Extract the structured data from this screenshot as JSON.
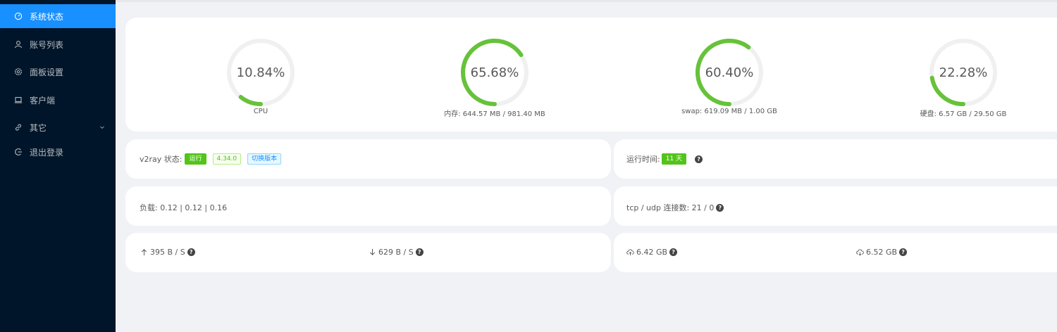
{
  "sidebar": {
    "items": [
      {
        "label": "系统状态",
        "icon": "dashboard-icon"
      },
      {
        "label": "账号列表",
        "icon": "user-icon"
      },
      {
        "label": "面板设置",
        "icon": "gear-icon"
      },
      {
        "label": "客户端",
        "icon": "laptop-icon"
      },
      {
        "label": "其它",
        "icon": "link-icon"
      },
      {
        "label": "退出登录",
        "icon": "logout-icon"
      }
    ]
  },
  "gauges": [
    {
      "percent_text": "10.84%",
      "value": 10.84,
      "caption": "CPU"
    },
    {
      "percent_text": "65.68%",
      "value": 65.68,
      "caption": "内存: 644.57 MB / 981.40 MB"
    },
    {
      "percent_text": "60.40%",
      "value": 60.4,
      "caption": "swap: 619.09 MB / 1.00 GB"
    },
    {
      "percent_text": "22.28%",
      "value": 22.28,
      "caption": "硬盘: 6.57 GB / 29.50 GB"
    }
  ],
  "v2ray": {
    "label": "v2ray 状态:",
    "status": "运行",
    "version": "4.34.0",
    "switch": "切换版本"
  },
  "uptime": {
    "label": "运行时间:",
    "value": "11 天",
    "help": "?"
  },
  "load": {
    "text": "负载: 0.12 | 0.12 | 0.16"
  },
  "connections": {
    "text": "tcp / udp 连接数: 21 / 0",
    "help": "?"
  },
  "traffic": {
    "upload_speed": "395 B / S",
    "download_speed": "629 B / S",
    "total_up": "6.42 GB",
    "total_down": "6.52 GB",
    "help": "?"
  },
  "colors": {
    "sidebar_bg": "#001529",
    "active": "#1890ff",
    "gauge": "#67c23a",
    "track": "#f0f0f0"
  }
}
